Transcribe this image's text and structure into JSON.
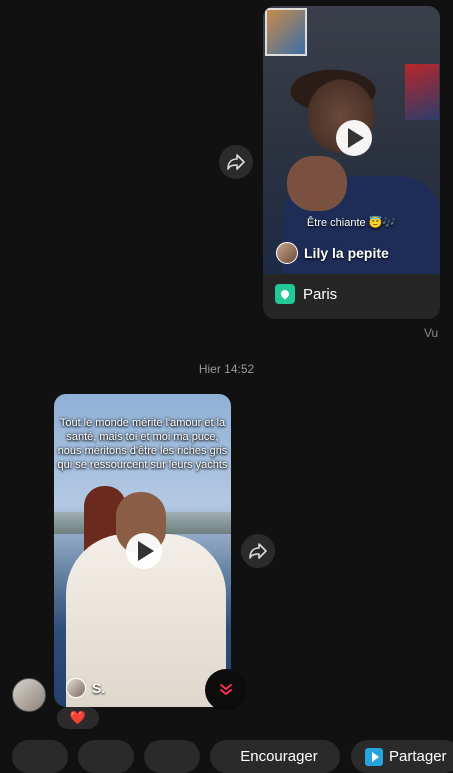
{
  "sent_message": {
    "video_caption": "Être chiante 😇🎶",
    "author_name": "Lily la pepite",
    "location": "Paris",
    "status": "Vu"
  },
  "timestamp": "Hier 14:52",
  "received_message": {
    "caption": "Tout le monde mérite l'amour et la santé, mais toi et moi ma puce, nous méritons d'être les riches gris qui se ressourcent sur leurs yachts",
    "author_name": "S.",
    "reaction": "❤️"
  },
  "quick_replies": {
    "chip1": "",
    "chip2": "",
    "chip3": "",
    "encourage": "Encourager",
    "share": "Partager"
  },
  "icons": {
    "share": "share-arrow-icon",
    "play": "play-icon",
    "location": "location-pin-icon",
    "scroll_down": "double-chevron-down-icon"
  },
  "colors": {
    "background": "#111111",
    "location_accent": "#20c997",
    "scroll_accent": "#ff2d55",
    "share_accent": "#27a4de"
  }
}
